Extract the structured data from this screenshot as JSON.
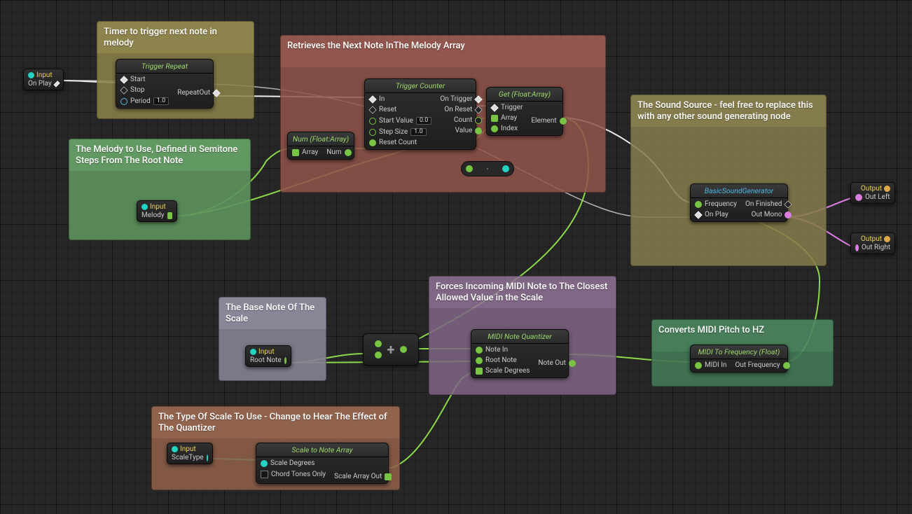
{
  "comments": {
    "timer": {
      "title": "Timer to trigger next note in melody",
      "color": "rgba(160,148,85,0.85)"
    },
    "retrieve": {
      "title": "Retrieves the Next Note InThe Melody Array",
      "color": "rgba(165,95,85,0.85)"
    },
    "melody": {
      "title": "The Melody to Use, Defined in Semitone Steps From The Root Note",
      "color": "rgba(105,165,105,0.9)"
    },
    "sound": {
      "title": "The Sound Source - feel free to replace this with any other sound generating node",
      "color": "rgba(150,140,85,0.85)"
    },
    "base": {
      "title": "The Base Note Of The Scale",
      "color": "rgba(150,145,165,0.9)"
    },
    "quantize": {
      "title": "Forces Incoming MIDI Note to The Closest Allowed Value in the Scale",
      "color": "rgba(145,115,150,0.85)"
    },
    "convert": {
      "title": "Converts MIDI Pitch to HZ",
      "color": "rgba(75,135,95,0.9)"
    },
    "scale": {
      "title": "The Type Of Scale To Use - Change to Hear The Effect of The Quantizer",
      "color": "rgba(165,110,85,0.85)"
    }
  },
  "inputs": {
    "onplay": {
      "hdr": "Input",
      "label": "On Play"
    },
    "melody": {
      "hdr": "Input",
      "label": "Melody"
    },
    "rootnote": {
      "hdr": "Input",
      "label": "Root Note"
    },
    "scaletype": {
      "hdr": "Input",
      "label": "ScaleType"
    }
  },
  "outputs": {
    "outleft": {
      "hdr": "Output",
      "label": "Out Left"
    },
    "outright": {
      "hdr": "Output",
      "label": "Out Right"
    }
  },
  "nodes": {
    "triggerRepeat": {
      "title": "Trigger Repeat",
      "pins": {
        "start": "Start",
        "stop": "Stop",
        "period": "Period",
        "periodVal": "1.0",
        "repeatOut": "RepeatOut"
      }
    },
    "numArray": {
      "title": "Num (Float:Array)",
      "pins": {
        "array": "Array",
        "num": "Num"
      }
    },
    "triggerCounter": {
      "title": "Trigger Counter",
      "pins": {
        "in": "In",
        "reset": "Reset",
        "startValue": "Start Value",
        "startVal": "0.0",
        "stepSize": "Step Size",
        "stepVal": "1.0",
        "resetCount": "Reset Count",
        "onTrigger": "On Trigger",
        "onReset": "On Reset",
        "count": "Count",
        "value": "Value"
      }
    },
    "getArray": {
      "title": "Get (Float:Array)",
      "pins": {
        "trigger": "Trigger",
        "array": "Array",
        "index": "Index",
        "element": "Element"
      }
    },
    "basicSound": {
      "title": "BasicSoundGenerator",
      "pins": {
        "frequency": "Frequency",
        "onPlay": "On Play",
        "onFinished": "On Finished",
        "outMono": "Out Mono"
      }
    },
    "midiQuant": {
      "title": "MIDI Note Quantizer",
      "pins": {
        "noteIn": "Note In",
        "rootNote": "Root Note",
        "scaleDegrees": "Scale Degrees",
        "noteOut": "Note Out"
      }
    },
    "midiToFreq": {
      "title": "MIDI To Frequency (Float)",
      "pins": {
        "midiIn": "MIDI In",
        "outFreq": "Out Frequency"
      }
    },
    "scaleToArray": {
      "title": "Scale to Note Array",
      "pins": {
        "scaleDegrees": "Scale Degrees",
        "chordTones": "Chord Tones Only",
        "scaleArrayOut": "Scale Array Out"
      }
    }
  }
}
